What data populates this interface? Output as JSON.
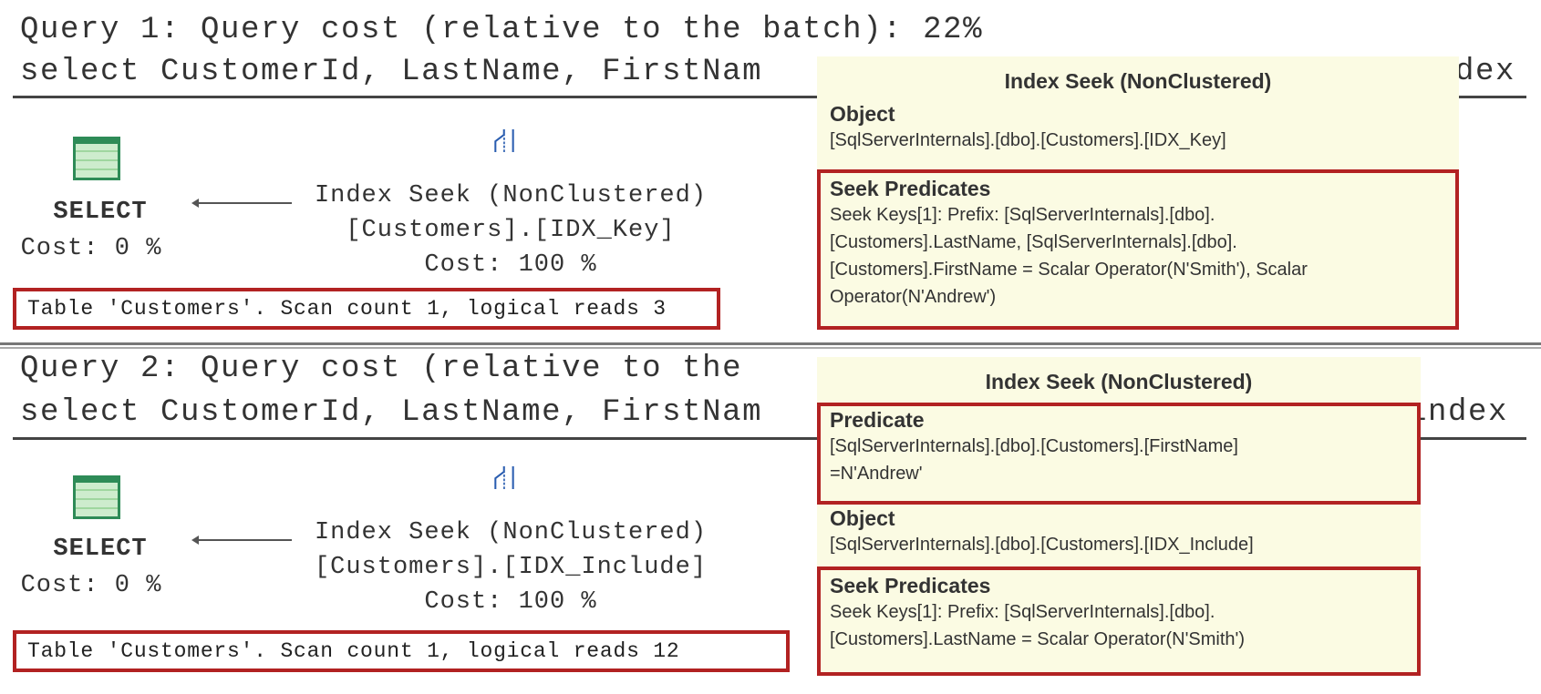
{
  "query1": {
    "header": "Query 1: Query cost (relative to the batch): 22%",
    "sql_left": "select CustomerId, LastName, FirstNam",
    "sql_right": "dex",
    "select_op": {
      "label": "SELECT",
      "cost": "Cost: 0 %"
    },
    "seek_op": {
      "label": "Index Seek (NonClustered)",
      "object": "[Customers].[IDX_Key]",
      "cost": "Cost: 100 %"
    },
    "stats": "Table 'Customers'. Scan count 1, logical reads 3",
    "tooltip": {
      "title": "Index Seek (NonClustered)",
      "object_label": "Object",
      "object_value": "[SqlServerInternals].[dbo].[Customers].[IDX_Key]",
      "seek_label": "Seek Predicates",
      "seek_lines": [
        "Seek Keys[1]: Prefix: [SqlServerInternals].[dbo].",
        "[Customers].LastName, [SqlServerInternals].[dbo].",
        "[Customers].FirstName = Scalar Operator(N'Smith'), Scalar",
        "Operator(N'Andrew')"
      ]
    }
  },
  "query2": {
    "header": "Query 2: Query cost (relative to the",
    "sql_left": "select CustomerId, LastName, FirstNam",
    "sql_right": "index",
    "select_op": {
      "label": "SELECT",
      "cost": "Cost: 0 %"
    },
    "seek_op": {
      "label": "Index Seek (NonClustered)",
      "object": "[Customers].[IDX_Include]",
      "cost": "Cost: 100 %"
    },
    "stats": "Table 'Customers'. Scan count 1, logical reads 12",
    "tooltip": {
      "title": "Index Seek (NonClustered)",
      "predicate_label": "Predicate",
      "predicate_lines": [
        "[SqlServerInternals].[dbo].[Customers].[FirstName]",
        "=N'Andrew'"
      ],
      "object_label": "Object",
      "object_value": "[SqlServerInternals].[dbo].[Customers].[IDX_Include]",
      "seek_label": "Seek Predicates",
      "seek_lines": [
        "Seek Keys[1]: Prefix: [SqlServerInternals].[dbo].",
        "[Customers].LastName = Scalar Operator(N'Smith')"
      ]
    }
  },
  "colors": {
    "highlight": "#b22222",
    "tooltip_bg": "#fbfbe3",
    "icon_blue": "#2a5db0",
    "icon_green": "#2e8b57"
  }
}
